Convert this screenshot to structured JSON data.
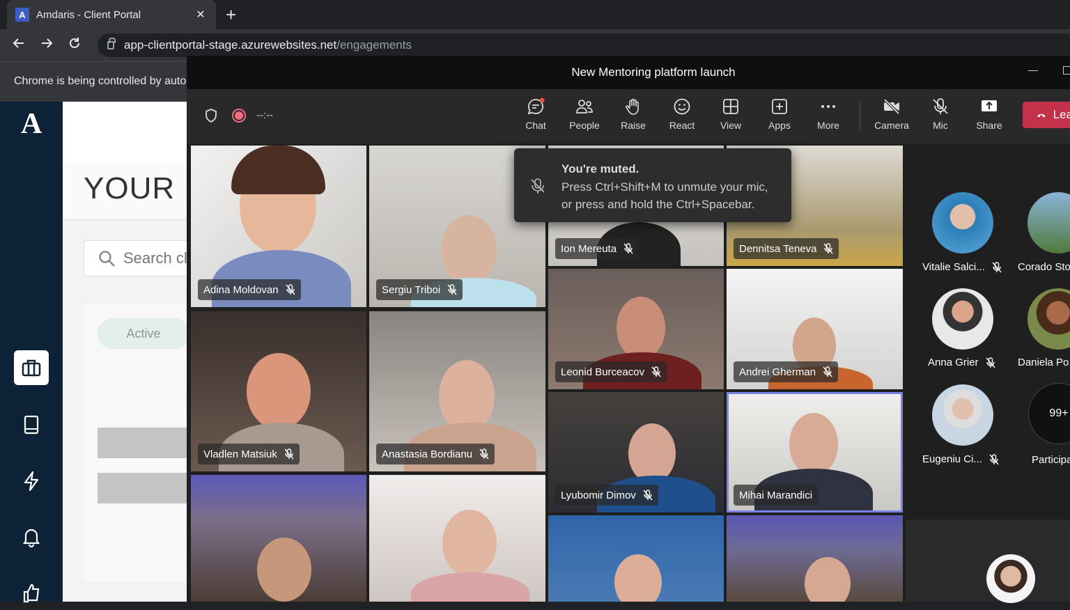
{
  "browser": {
    "tab_title": "Amdaris - Client Portal",
    "tab_favicon": "A",
    "url_host": "app-clientportal-stage.azurewebsites.net",
    "url_path": "/engagements",
    "infobar_text": "Chrome is being controlled by automated test software."
  },
  "app": {
    "logo": "A",
    "page_title": "YOUR ENGAGEMENTS",
    "search_placeholder": "Search clients",
    "filter_active": "Active",
    "nav": [
      "briefcase-icon",
      "book-icon",
      "lightning-icon",
      "bell-icon",
      "thumbs-up-icon"
    ]
  },
  "teams": {
    "meeting_title": "New Mentoring platform launch",
    "timer": "--:--",
    "toolbar": {
      "chat": "Chat",
      "people": "People",
      "raise": "Raise",
      "react": "React",
      "view": "View",
      "apps": "Apps",
      "more": "More",
      "camera": "Camera",
      "mic": "Mic",
      "share": "Share",
      "leave": "Leave"
    },
    "toast": {
      "title": "You're muted.",
      "line1": "Press Ctrl+Shift+M to unmute your mic,",
      "line2": "or press and hold the Ctrl+Spacebar."
    },
    "participants": [
      "Adina Moldovan",
      "Sergiu Triboi",
      "Ion Mereuta",
      "Dennitsa Teneva",
      "Vladlen Matsiuk",
      "Anastasia Bordianu",
      "Leonid Burceacov",
      "Andrei Gherman",
      "Lyubomir Dimov",
      "Mihai Marandici"
    ],
    "roster": [
      "Vitalie Salci...",
      "Corado Sto",
      "Anna Grier",
      "Daniela Po...",
      "Eugeniu Ci..."
    ],
    "overflow_count": "99+",
    "overflow_label": "Participa"
  }
}
